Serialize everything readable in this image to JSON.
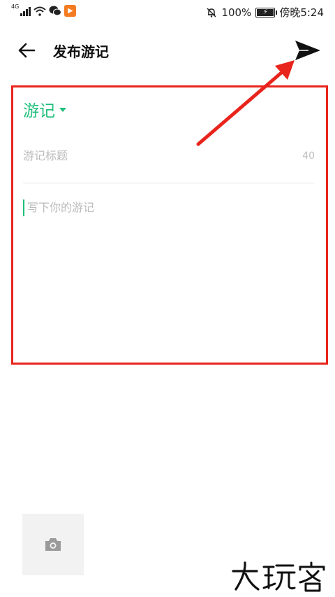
{
  "status_bar": {
    "network": "4G",
    "battery_percent": "100%",
    "time": "傍晚5:24",
    "app_badge_letter": "▶"
  },
  "header": {
    "title": "发布游记"
  },
  "editor": {
    "category": "游记",
    "title_placeholder": "游记标题",
    "title_char_limit": "40",
    "body_placeholder": "写下你的游记"
  },
  "watermark": {
    "text": "大玩客"
  },
  "colors": {
    "accent_green": "#1fbf7a",
    "annotation_red": "#e8241c"
  }
}
